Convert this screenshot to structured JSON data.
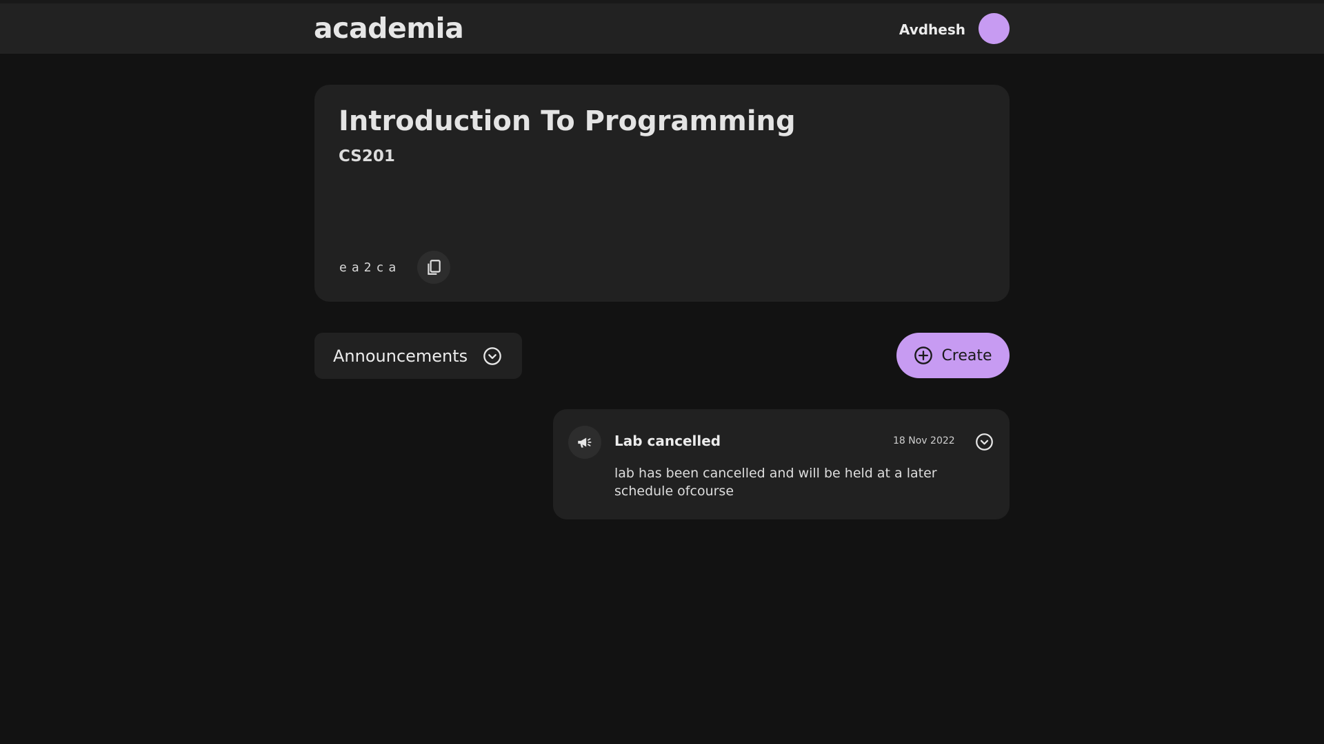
{
  "navbar": {
    "brand": "academia",
    "user_name": "Avdhesh",
    "avatar_color": "#c79bf2"
  },
  "course": {
    "title": "Introduction To Programming",
    "code": "CS201",
    "class_code": "ea2ca",
    "copy_icon": "copy-icon"
  },
  "announcements": {
    "dropdown_label": "Announcements",
    "dropdown_icon": "chevron-down-icon",
    "create_label": "Create",
    "create_icon": "plus-circle-icon",
    "accent_color": "#c79bf2",
    "posts": [
      {
        "icon": "megaphone-icon",
        "title": "Lab cancelled",
        "date": "18 Nov 2022",
        "body": "lab has been cancelled and will be held at a later schedule ofcourse"
      }
    ]
  }
}
